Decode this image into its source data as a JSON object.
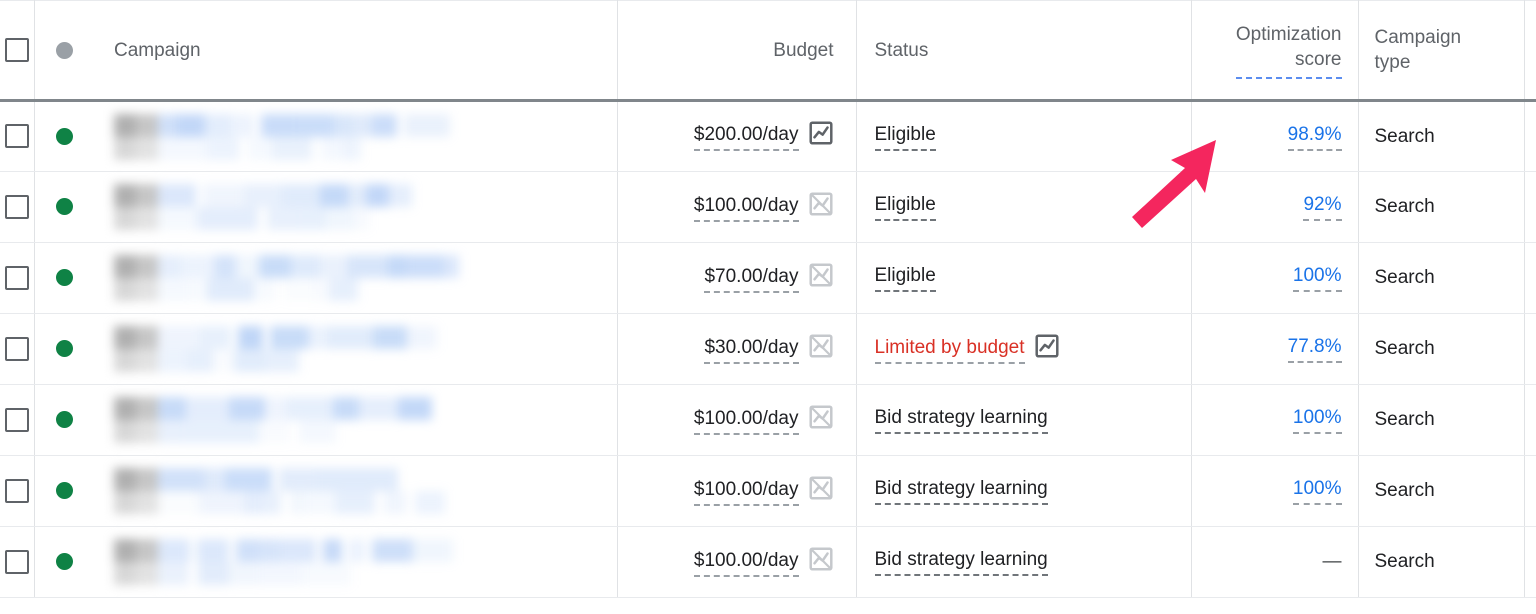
{
  "table": {
    "columns": [
      {
        "key": "select",
        "label": "",
        "icon": "checkbox-icon"
      },
      {
        "key": "status_dot",
        "label": "",
        "icon": "status-dot-icon"
      },
      {
        "key": "campaign",
        "label": "Campaign"
      },
      {
        "key": "budget",
        "label": "Budget"
      },
      {
        "key": "status",
        "label": "Status"
      },
      {
        "key": "optimization",
        "label_line1": "Optimization",
        "label_line2": "score"
      },
      {
        "key": "campaign_type",
        "label_line1": "Campaign",
        "label_line2": "type"
      }
    ],
    "rows": [
      {
        "checkbox_checked": false,
        "status_dot": "green",
        "campaign_name": "",
        "campaign_name_redacted": true,
        "budget": "$200.00/day",
        "budget_chart_icon": "chart-icon-active",
        "status": "Eligible",
        "status_tone": "normal",
        "status_chart_icon": "",
        "optimization_score": "98.9%",
        "campaign_type": "Search"
      },
      {
        "checkbox_checked": false,
        "status_dot": "green",
        "campaign_name": "",
        "campaign_name_redacted": true,
        "budget": "$100.00/day",
        "budget_chart_icon": "chart-icon-disabled",
        "status": "Eligible",
        "status_tone": "normal",
        "status_chart_icon": "",
        "optimization_score": "92%",
        "campaign_type": "Search"
      },
      {
        "checkbox_checked": false,
        "status_dot": "green",
        "campaign_name": "",
        "campaign_name_redacted": true,
        "budget": "$70.00/day",
        "budget_chart_icon": "chart-icon-disabled",
        "status": "Eligible",
        "status_tone": "normal",
        "status_chart_icon": "",
        "optimization_score": "100%",
        "campaign_type": "Search"
      },
      {
        "checkbox_checked": false,
        "status_dot": "green",
        "campaign_name": "",
        "campaign_name_redacted": true,
        "budget": "$30.00/day",
        "budget_chart_icon": "chart-icon-disabled",
        "status": "Limited by budget",
        "status_tone": "warning",
        "status_chart_icon": "chart-icon-active",
        "optimization_score": "77.8%",
        "campaign_type": "Search"
      },
      {
        "checkbox_checked": false,
        "status_dot": "green",
        "campaign_name": "",
        "campaign_name_redacted": true,
        "budget": "$100.00/day",
        "budget_chart_icon": "chart-icon-disabled",
        "status": "Bid strategy learning",
        "status_tone": "normal",
        "status_chart_icon": "",
        "optimization_score": "100%",
        "campaign_type": "Search"
      },
      {
        "checkbox_checked": false,
        "status_dot": "green",
        "campaign_name": "",
        "campaign_name_redacted": true,
        "budget": "$100.00/day",
        "budget_chart_icon": "chart-icon-disabled",
        "status": "Bid strategy learning",
        "status_tone": "normal",
        "status_chart_icon": "",
        "optimization_score": "100%",
        "campaign_type": "Search"
      },
      {
        "checkbox_checked": false,
        "status_dot": "green",
        "campaign_name": "",
        "campaign_name_redacted": true,
        "budget": "$100.00/day",
        "budget_chart_icon": "chart-icon-disabled",
        "status": "Bid strategy learning",
        "status_tone": "normal",
        "status_chart_icon": "",
        "optimization_score": "—",
        "campaign_type": "Search"
      }
    ]
  },
  "annotation": {
    "type": "arrow",
    "color": "#f4265e",
    "points_to": "optimization-score-cell-row-1"
  },
  "colors": {
    "link_blue": "#1a73e8",
    "header_underline_blue": "#5b8def",
    "status_warning_red": "#d93025",
    "status_dot_green": "#0f8245",
    "status_dot_gray": "#9aa0a6",
    "header_text": "#5f6368",
    "body_text": "#202124",
    "grid_line": "#e8eaed",
    "header_rule": "#80868b",
    "annotation_arrow": "#f4265e"
  }
}
